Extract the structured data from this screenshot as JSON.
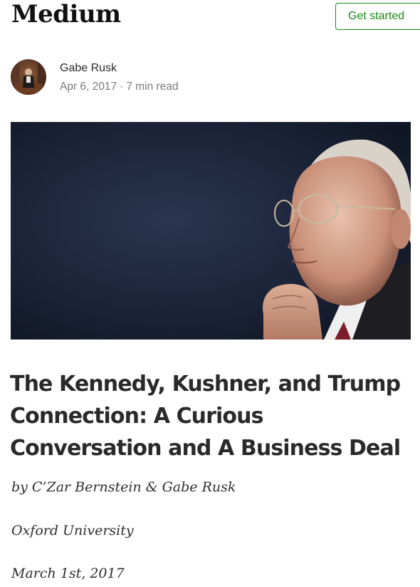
{
  "header": {
    "logo": "Medium",
    "get_started_label": "Get started"
  },
  "author": {
    "name": "Gabe Rusk",
    "date": "Apr 6, 2017",
    "separator": "·",
    "read_time": "7 min read"
  },
  "article": {
    "title": "The Kennedy, Kushner, and Trump Connection: A Curious Conversation and A Business Deal",
    "byline": "by C’Zar Bernstein & Gabe Rusk",
    "affiliation": "Oxford University",
    "date": "March 1st, 2017"
  },
  "colors": {
    "accent": "#1a8917",
    "meta_text": "#7a7a7a",
    "hero_background": "#1c2436"
  },
  "icons": {
    "avatar": "author-avatar-photo"
  }
}
